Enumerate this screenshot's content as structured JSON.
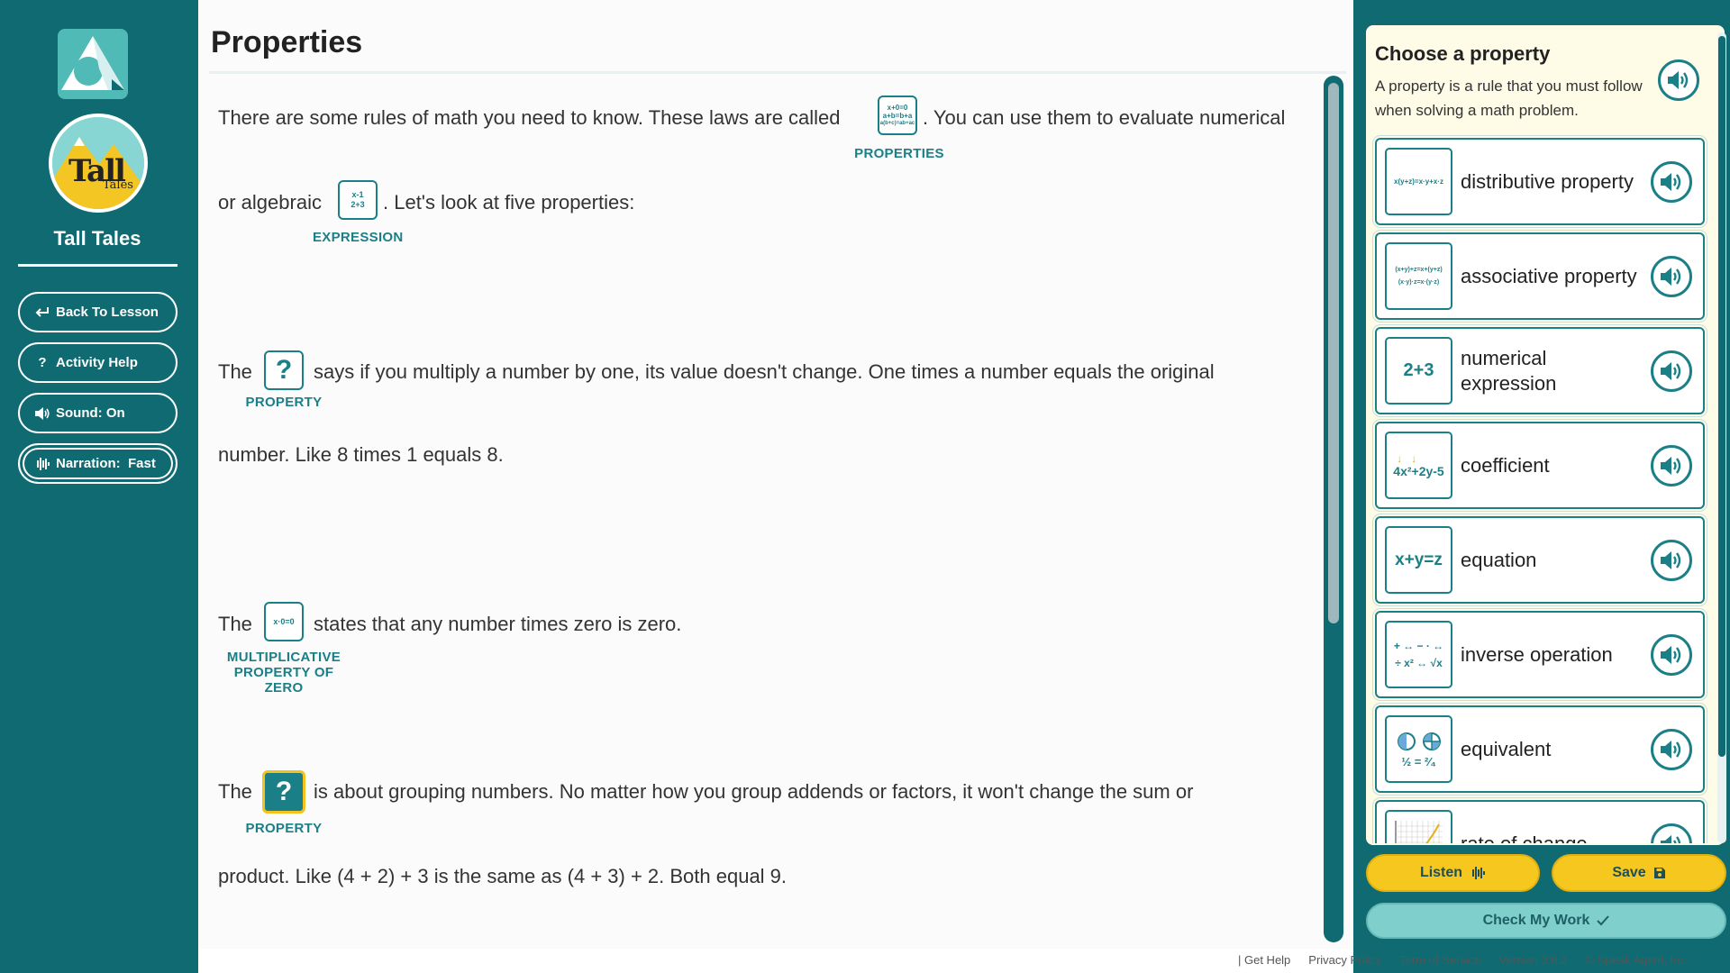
{
  "sidebar": {
    "book_title": "Tall Tales",
    "book_cover_text": "Tall",
    "book_cover_subtext": "Tales",
    "buttons": [
      {
        "label": "Back To Lesson",
        "icon": "return-arrow-icon"
      },
      {
        "label": "Activity Help",
        "icon": "question-icon"
      },
      {
        "label": "Sound: On",
        "icon": "speaker-icon"
      },
      {
        "label": "Narration:  Fast",
        "icon": "waveform-icon"
      }
    ]
  },
  "main": {
    "title": "Properties",
    "para1": {
      "before": "There are some rules of math you need to know. These laws are called",
      "after": ". You can use them to evaluate numerical",
      "term_label": "PROPERTIES",
      "term_icon_lines": [
        "x+0=0",
        "a+b=b+a",
        "a(b+c)=ab+ac"
      ]
    },
    "para1b": {
      "before": "or algebraic",
      "after": ". Let's look at five properties:",
      "term_label": "EXPRESSION",
      "term_icon_lines": [
        "x-1",
        "2+3"
      ]
    },
    "para2": {
      "before": "The",
      "after": "says if you multiply a number by one, its value doesn't change. One times a number equals the original",
      "term_glyph": "?",
      "term_label": "PROPERTY"
    },
    "para2b": "number. Like 8 times 1 equals 8.",
    "para3": {
      "before": "The",
      "after": "states that any number times zero is zero.",
      "term_icon": "x·0=0",
      "term_label_lines": [
        "MULTIPLICATIVE",
        "PROPERTY OF",
        "ZERO"
      ]
    },
    "para4": {
      "before": "The",
      "after": "is about grouping numbers. No matter how you group addends or factors, it won't change the sum or",
      "term_glyph": "?",
      "term_label": "PROPERTY"
    },
    "para4b": "product. Like (4 + 2) + 3 is the same as (4 + 3) + 2. Both equal 9."
  },
  "panel": {
    "heading": "Choose a property",
    "description": "A property is a rule that you must follow when solving a math problem.",
    "items": [
      {
        "label": "distributive property",
        "icon_text": "x(y+z)=x·y+x·z"
      },
      {
        "label": "associative property",
        "icon_text": "(x+y)+z=x+(y+z) (x·y)·z=x·(y·z)"
      },
      {
        "label": "numerical expression",
        "icon_text": "2+3"
      },
      {
        "label": "coefficient",
        "icon_text": "4x²+2y-5"
      },
      {
        "label": "equation",
        "icon_text": "x+y=z"
      },
      {
        "label": "inverse operation",
        "icon_text": "+ ↔ −  · ↔ ÷  x² ↔ √x"
      },
      {
        "label": "equivalent",
        "icon_text": "½ = ²⁄₄"
      },
      {
        "label": "rate of change",
        "icon_text": "graph"
      }
    ],
    "listen_label": "Listen",
    "save_label": "Save",
    "check_label": "Check My Work"
  },
  "footer": {
    "links": [
      "| Get Help",
      "Privacy Policy",
      "Term of Service",
      "Version 3.6.2",
      "© Speak Agent, Inc."
    ]
  },
  "colors": {
    "teal_dark": "#106a72",
    "teal_accent": "#1a7f86",
    "yellow": "#f6c71e",
    "panel_bg": "#fefbe7"
  }
}
